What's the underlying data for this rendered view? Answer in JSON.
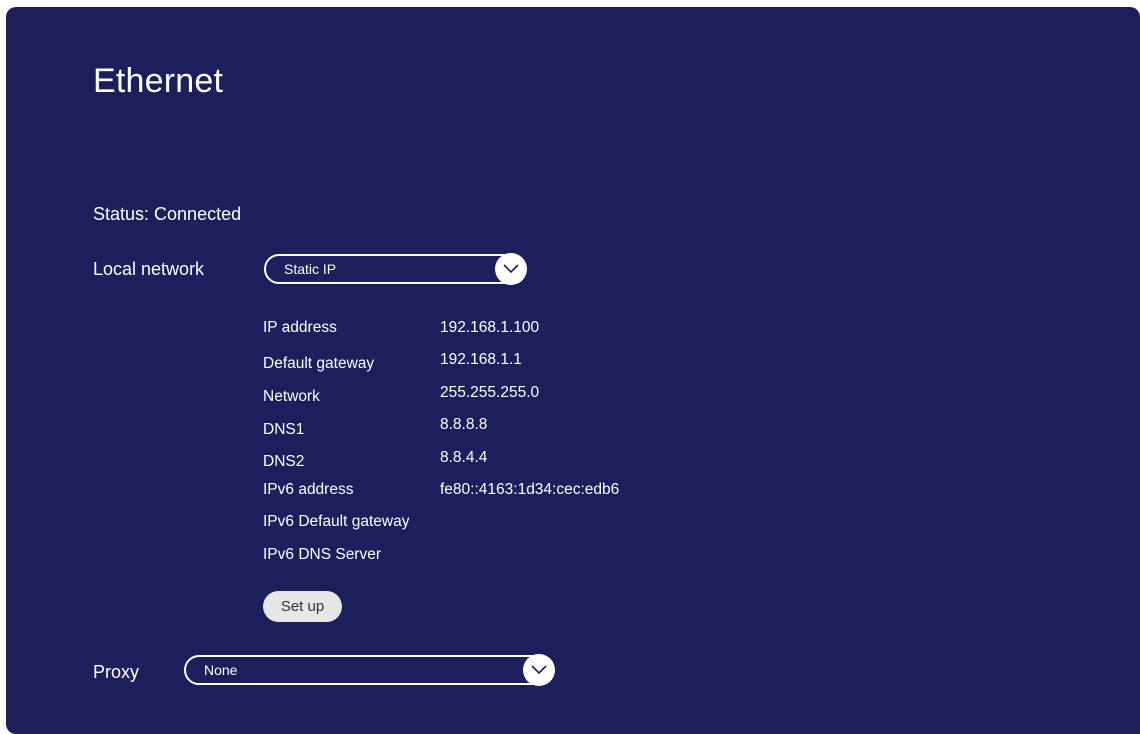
{
  "page": {
    "title": "Ethernet",
    "status": "Status: Connected"
  },
  "local_network": {
    "label": "Local network",
    "selected": "Static IP",
    "icon": "chevron-down-icon"
  },
  "details": [
    {
      "label": "IP address",
      "value": "192.168.1.100"
    },
    {
      "label": "Default gateway",
      "value": "192.168.1.1"
    },
    {
      "label": "Network",
      "value": "255.255.255.0"
    },
    {
      "label": "DNS1",
      "value": "8.8.8.8"
    },
    {
      "label": "DNS2",
      "value": "8.8.4.4"
    },
    {
      "label": "IPv6 address",
      "value": "fe80::4163:1d34:cec:edb6"
    },
    {
      "label": "IPv6 Default gateway",
      "value": ""
    },
    {
      "label": "IPv6 DNS Server",
      "value": ""
    }
  ],
  "setup_button": {
    "label": "Set up"
  },
  "proxy": {
    "label": "Proxy",
    "selected": "None",
    "icon": "chevron-down-icon"
  },
  "colors": {
    "background": "#1c1f5c",
    "text": "#ffffff",
    "button": "#e6e6e6"
  }
}
